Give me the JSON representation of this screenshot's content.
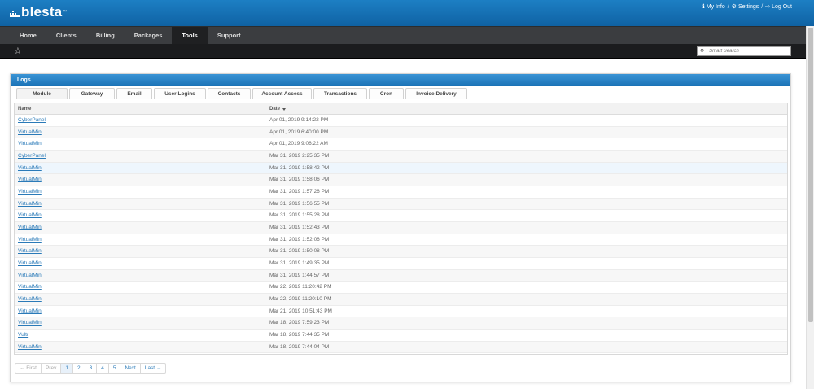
{
  "header": {
    "logo_text": "blesta",
    "logo_tm": "™",
    "links": [
      {
        "label": "My Info",
        "icon": "info-icon"
      },
      {
        "label": "Settings",
        "icon": "gear-icon"
      },
      {
        "label": "Log Out",
        "icon": "logout-icon"
      }
    ],
    "separator": "/"
  },
  "nav": {
    "items": [
      "Home",
      "Clients",
      "Billing",
      "Packages",
      "Tools",
      "Support"
    ],
    "active": "Tools"
  },
  "subbar": {
    "search_placeholder": "Smart Search"
  },
  "panel": {
    "title": "Logs",
    "tabs": [
      "Module",
      "Gateway",
      "Email",
      "User Logins",
      "Contacts",
      "Account Access",
      "Transactions",
      "Cron",
      "Invoice Delivery"
    ],
    "active_tab": "Module",
    "columns": {
      "name": "Name",
      "date": "Date"
    },
    "rows": [
      {
        "name": "CyberPanel",
        "date": "Apr 01, 2019 9:14:22 PM"
      },
      {
        "name": "VirtualMin",
        "date": "Apr 01, 2019 6:40:00 PM"
      },
      {
        "name": "VirtualMin",
        "date": "Apr 01, 2019 9:06:22 AM"
      },
      {
        "name": "CyberPanel",
        "date": "Mar 31, 2019 2:25:35 PM"
      },
      {
        "name": "VirtualMin",
        "date": "Mar 31, 2019 1:58:42 PM"
      },
      {
        "name": "VirtualMin",
        "date": "Mar 31, 2019 1:58:06 PM"
      },
      {
        "name": "VirtualMin",
        "date": "Mar 31, 2019 1:57:26 PM"
      },
      {
        "name": "VirtualMin",
        "date": "Mar 31, 2019 1:56:55 PM"
      },
      {
        "name": "VirtualMin",
        "date": "Mar 31, 2019 1:55:28 PM"
      },
      {
        "name": "VirtualMin",
        "date": "Mar 31, 2019 1:52:43 PM"
      },
      {
        "name": "VirtualMin",
        "date": "Mar 31, 2019 1:52:06 PM"
      },
      {
        "name": "VirtualMin",
        "date": "Mar 31, 2019 1:50:08 PM"
      },
      {
        "name": "VirtualMin",
        "date": "Mar 31, 2019 1:49:35 PM"
      },
      {
        "name": "VirtualMin",
        "date": "Mar 31, 2019 1:44:57 PM"
      },
      {
        "name": "VirtualMin",
        "date": "Mar 22, 2019 11:20:42 PM"
      },
      {
        "name": "VirtualMin",
        "date": "Mar 22, 2019 11:20:10 PM"
      },
      {
        "name": "VirtualMin",
        "date": "Mar 21, 2019 10:51:43 PM"
      },
      {
        "name": "VirtualMin",
        "date": "Mar 18, 2019 7:59:23 PM"
      },
      {
        "name": "Vultr",
        "date": "Mar 18, 2019 7:44:35 PM"
      },
      {
        "name": "VirtualMin",
        "date": "Mar 18, 2019 7:44:04 PM"
      }
    ]
  },
  "pagination": {
    "first": "← First",
    "prev": "Prev",
    "pages": [
      "1",
      "2",
      "3",
      "4",
      "5"
    ],
    "current": "1",
    "next": "Next",
    "last": "Last →"
  }
}
